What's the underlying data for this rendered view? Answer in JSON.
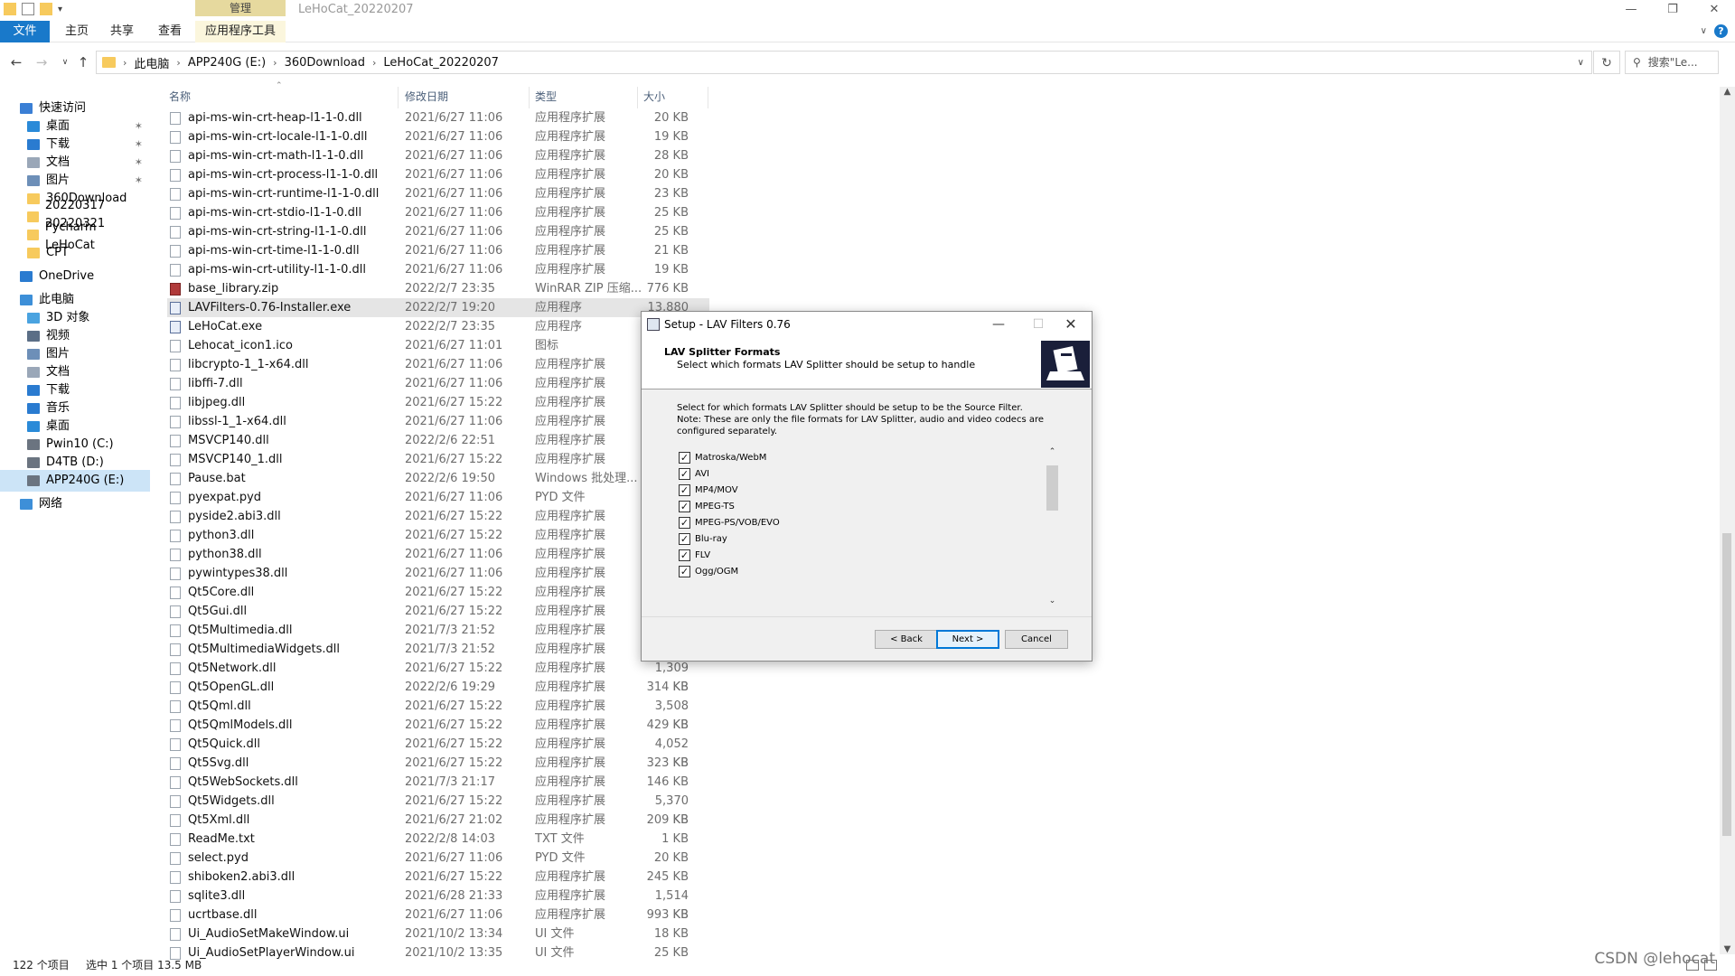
{
  "window": {
    "title": "LeHoCat_20220207",
    "context_group": "管理",
    "tabs": [
      "文件",
      "主页",
      "共享",
      "查看",
      "应用程序工具"
    ]
  },
  "address": {
    "crumbs": [
      "此电脑",
      "APP240G (E:)",
      "360Download",
      "LeHoCat_20220207"
    ],
    "search_placeholder": "搜索\"Le..."
  },
  "nav": {
    "items": [
      {
        "label": "快速访问",
        "icon": "star-icon"
      },
      {
        "label": "桌面",
        "icon": "desktop-icon",
        "pinned": true
      },
      {
        "label": "下载",
        "icon": "download-icon",
        "pinned": true
      },
      {
        "label": "文档",
        "icon": "document-icon",
        "pinned": true
      },
      {
        "label": "图片",
        "icon": "picture-icon",
        "pinned": true
      },
      {
        "label": "360Download",
        "icon": "folder-icon"
      },
      {
        "label": "20220317 Pycharm",
        "icon": "folder-icon"
      },
      {
        "label": "20220321 LeHoCat",
        "icon": "folder-icon"
      },
      {
        "label": "CPT",
        "icon": "folder-icon"
      },
      {
        "label": "OneDrive",
        "icon": "cloud-icon"
      },
      {
        "label": "此电脑",
        "icon": "computer-icon"
      },
      {
        "label": "3D 对象",
        "icon": "cube-icon"
      },
      {
        "label": "视频",
        "icon": "video-icon"
      },
      {
        "label": "图片",
        "icon": "picture-icon"
      },
      {
        "label": "文档",
        "icon": "document-icon"
      },
      {
        "label": "下载",
        "icon": "download-icon"
      },
      {
        "label": "音乐",
        "icon": "music-icon"
      },
      {
        "label": "桌面",
        "icon": "desktop-icon"
      },
      {
        "label": "Pwin10 (C:)",
        "icon": "drive-icon"
      },
      {
        "label": "D4TB (D:)",
        "icon": "drive-icon"
      },
      {
        "label": "APP240G (E:)",
        "icon": "drive-icon",
        "selected": true
      },
      {
        "label": "网络",
        "icon": "network-icon"
      }
    ]
  },
  "columns": [
    "名称",
    "修改日期",
    "类型",
    "大小"
  ],
  "files": [
    {
      "name": "api-ms-win-crt-heap-l1-1-0.dll",
      "date": "2021/6/27 11:06",
      "type": "应用程序扩展",
      "size": "20 KB"
    },
    {
      "name": "api-ms-win-crt-locale-l1-1-0.dll",
      "date": "2021/6/27 11:06",
      "type": "应用程序扩展",
      "size": "19 KB"
    },
    {
      "name": "api-ms-win-crt-math-l1-1-0.dll",
      "date": "2021/6/27 11:06",
      "type": "应用程序扩展",
      "size": "28 KB"
    },
    {
      "name": "api-ms-win-crt-process-l1-1-0.dll",
      "date": "2021/6/27 11:06",
      "type": "应用程序扩展",
      "size": "20 KB"
    },
    {
      "name": "api-ms-win-crt-runtime-l1-1-0.dll",
      "date": "2021/6/27 11:06",
      "type": "应用程序扩展",
      "size": "23 KB"
    },
    {
      "name": "api-ms-win-crt-stdio-l1-1-0.dll",
      "date": "2021/6/27 11:06",
      "type": "应用程序扩展",
      "size": "25 KB"
    },
    {
      "name": "api-ms-win-crt-string-l1-1-0.dll",
      "date": "2021/6/27 11:06",
      "type": "应用程序扩展",
      "size": "25 KB"
    },
    {
      "name": "api-ms-win-crt-time-l1-1-0.dll",
      "date": "2021/6/27 11:06",
      "type": "应用程序扩展",
      "size": "21 KB"
    },
    {
      "name": "api-ms-win-crt-utility-l1-1-0.dll",
      "date": "2021/6/27 11:06",
      "type": "应用程序扩展",
      "size": "19 KB"
    },
    {
      "name": "base_library.zip",
      "date": "2022/2/7 23:35",
      "type": "WinRAR ZIP 压缩...",
      "size": "776 KB"
    },
    {
      "name": "LAVFilters-0.76-Installer.exe",
      "date": "2022/2/7 19:20",
      "type": "应用程序",
      "size": "13,880 KB",
      "highlight": true
    },
    {
      "name": "LeHoCat.exe",
      "date": "2022/2/7 23:35",
      "type": "应用程序",
      "size": ""
    },
    {
      "name": "Lehocat_icon1.ico",
      "date": "2021/6/27 11:01",
      "type": "图标",
      "size": ""
    },
    {
      "name": "libcrypto-1_1-x64.dll",
      "date": "2021/6/27 11:06",
      "type": "应用程序扩展",
      "size": ""
    },
    {
      "name": "libffi-7.dll",
      "date": "2021/6/27 11:06",
      "type": "应用程序扩展",
      "size": ""
    },
    {
      "name": "libjpeg.dll",
      "date": "2021/6/27 15:22",
      "type": "应用程序扩展",
      "size": ""
    },
    {
      "name": "libssl-1_1-x64.dll",
      "date": "2021/6/27 11:06",
      "type": "应用程序扩展",
      "size": ""
    },
    {
      "name": "MSVCP140.dll",
      "date": "2022/2/6 22:51",
      "type": "应用程序扩展",
      "size": ""
    },
    {
      "name": "MSVCP140_1.dll",
      "date": "2021/6/27 15:22",
      "type": "应用程序扩展",
      "size": ""
    },
    {
      "name": "Pause.bat",
      "date": "2022/2/6 19:50",
      "type": "Windows 批处理...",
      "size": ""
    },
    {
      "name": "pyexpat.pyd",
      "date": "2021/6/27 11:06",
      "type": "PYD 文件",
      "size": ""
    },
    {
      "name": "pyside2.abi3.dll",
      "date": "2021/6/27 15:22",
      "type": "应用程序扩展",
      "size": ""
    },
    {
      "name": "python3.dll",
      "date": "2021/6/27 15:22",
      "type": "应用程序扩展",
      "size": ""
    },
    {
      "name": "python38.dll",
      "date": "2021/6/27 11:06",
      "type": "应用程序扩展",
      "size": ""
    },
    {
      "name": "pywintypes38.dll",
      "date": "2021/6/27 11:06",
      "type": "应用程序扩展",
      "size": ""
    },
    {
      "name": "Qt5Core.dll",
      "date": "2021/6/27 15:22",
      "type": "应用程序扩展",
      "size": ""
    },
    {
      "name": "Qt5Gui.dll",
      "date": "2021/6/27 15:22",
      "type": "应用程序扩展",
      "size": ""
    },
    {
      "name": "Qt5Multimedia.dll",
      "date": "2021/7/3 21:52",
      "type": "应用程序扩展",
      "size": ""
    },
    {
      "name": "Qt5MultimediaWidgets.dll",
      "date": "2021/7/3 21:52",
      "type": "应用程序扩展",
      "size": ""
    },
    {
      "name": "Qt5Network.dll",
      "date": "2021/6/27 15:22",
      "type": "应用程序扩展",
      "size": "1,309 KB"
    },
    {
      "name": "Qt5OpenGL.dll",
      "date": "2022/2/6 19:29",
      "type": "应用程序扩展",
      "size": "314 KB"
    },
    {
      "name": "Qt5Qml.dll",
      "date": "2021/6/27 15:22",
      "type": "应用程序扩展",
      "size": "3,508 KB"
    },
    {
      "name": "Qt5QmlModels.dll",
      "date": "2021/6/27 15:22",
      "type": "应用程序扩展",
      "size": "429 KB"
    },
    {
      "name": "Qt5Quick.dll",
      "date": "2021/6/27 15:22",
      "type": "应用程序扩展",
      "size": "4,052 KB"
    },
    {
      "name": "Qt5Svg.dll",
      "date": "2021/6/27 15:22",
      "type": "应用程序扩展",
      "size": "323 KB"
    },
    {
      "name": "Qt5WebSockets.dll",
      "date": "2021/7/3 21:17",
      "type": "应用程序扩展",
      "size": "146 KB"
    },
    {
      "name": "Qt5Widgets.dll",
      "date": "2021/6/27 15:22",
      "type": "应用程序扩展",
      "size": "5,370 KB"
    },
    {
      "name": "Qt5Xml.dll",
      "date": "2021/6/27 21:02",
      "type": "应用程序扩展",
      "size": "209 KB"
    },
    {
      "name": "ReadMe.txt",
      "date": "2022/2/8 14:03",
      "type": "TXT 文件",
      "size": "1 KB"
    },
    {
      "name": "select.pyd",
      "date": "2021/6/27 11:06",
      "type": "PYD 文件",
      "size": "20 KB"
    },
    {
      "name": "shiboken2.abi3.dll",
      "date": "2021/6/27 15:22",
      "type": "应用程序扩展",
      "size": "245 KB"
    },
    {
      "name": "sqlite3.dll",
      "date": "2021/6/28 21:33",
      "type": "应用程序扩展",
      "size": "1,514 KB"
    },
    {
      "name": "ucrtbase.dll",
      "date": "2021/6/27 11:06",
      "type": "应用程序扩展",
      "size": "993 KB"
    },
    {
      "name": "Ui_AudioSetMakeWindow.ui",
      "date": "2021/10/2 13:34",
      "type": "UI 文件",
      "size": "18 KB"
    },
    {
      "name": "Ui_AudioSetPlayerWindow.ui",
      "date": "2021/10/2 13:35",
      "type": "UI 文件",
      "size": "25 KB"
    }
  ],
  "status": {
    "count": "122 个项目",
    "selected": "选中 1 个项目  13.5 MB"
  },
  "watermark": "CSDN @lehocat",
  "dialog": {
    "title": "Setup - LAV Filters 0.76",
    "header_title": "LAV Splitter Formats",
    "header_sub": "Select which formats LAV Splitter should be setup to handle",
    "desc1": "Select for which formats LAV Splitter should be setup to be the Source Filter.",
    "desc2": "Note: These are only the file formats for LAV Splitter, audio and video codecs are",
    "desc3": "configured separately.",
    "formats": [
      "Matroska/WebM",
      "AVI",
      "MP4/MOV",
      "MPEG-TS",
      "MPEG-PS/VOB/EVO",
      "Blu-ray",
      "FLV",
      "Ogg/OGM"
    ],
    "back": "< Back",
    "next": "Next >",
    "cancel": "Cancel"
  },
  "colors": {
    "accent": "#1979ca",
    "context_tab": "#e6d99e",
    "selection": "#cce4f7",
    "folder": "#f7ca5d"
  }
}
